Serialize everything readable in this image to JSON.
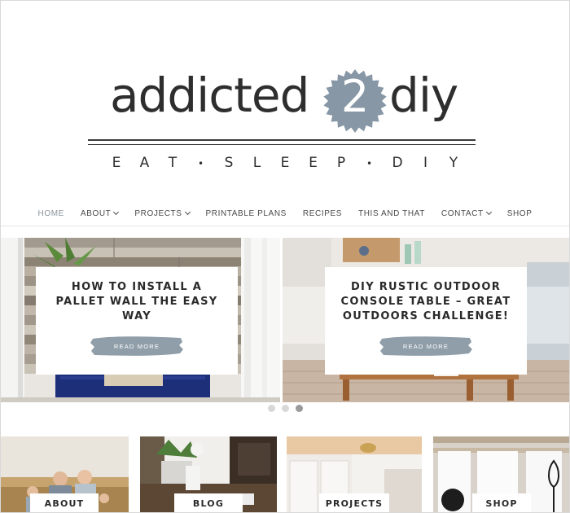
{
  "logo": {
    "word_left": "addicted",
    "badge_number": "2",
    "word_right": "diy",
    "tagline": [
      "E",
      "A",
      "T",
      "•",
      "S",
      "L",
      "E",
      "E",
      "P",
      "•",
      "D",
      "I",
      "Y"
    ],
    "badge_color": "#8797a5"
  },
  "nav": {
    "items": [
      {
        "label": "HOME",
        "active": true,
        "dropdown": false
      },
      {
        "label": "ABOUT",
        "active": false,
        "dropdown": true
      },
      {
        "label": "PROJECTS",
        "active": false,
        "dropdown": true
      },
      {
        "label": "PRINTABLE PLANS",
        "active": false,
        "dropdown": false
      },
      {
        "label": "RECIPES",
        "active": false,
        "dropdown": false
      },
      {
        "label": "THIS AND THAT",
        "active": false,
        "dropdown": false
      },
      {
        "label": "CONTACT",
        "active": false,
        "dropdown": true
      },
      {
        "label": "SHOP",
        "active": false,
        "dropdown": false
      }
    ],
    "active_color": "#8a959c"
  },
  "slider": {
    "slides": [
      {
        "title_lines": [
          "HOW TO INSTALL A",
          "PALLET WALL THE EASY",
          "WAY"
        ],
        "button": "READ MORE"
      },
      {
        "title_lines": [
          "DIY RUSTIC OUTDOOR",
          "CONSOLE TABLE – GREAT",
          "OUTDOORS CHALLENGE!"
        ],
        "button": "READ MORE"
      }
    ],
    "dots": [
      false,
      false,
      true
    ],
    "button_color": "#8f9ea9"
  },
  "tiles": [
    {
      "label": "ABOUT"
    },
    {
      "label": "BLOG"
    },
    {
      "label": "PROJECTS"
    },
    {
      "label": "SHOP"
    }
  ]
}
